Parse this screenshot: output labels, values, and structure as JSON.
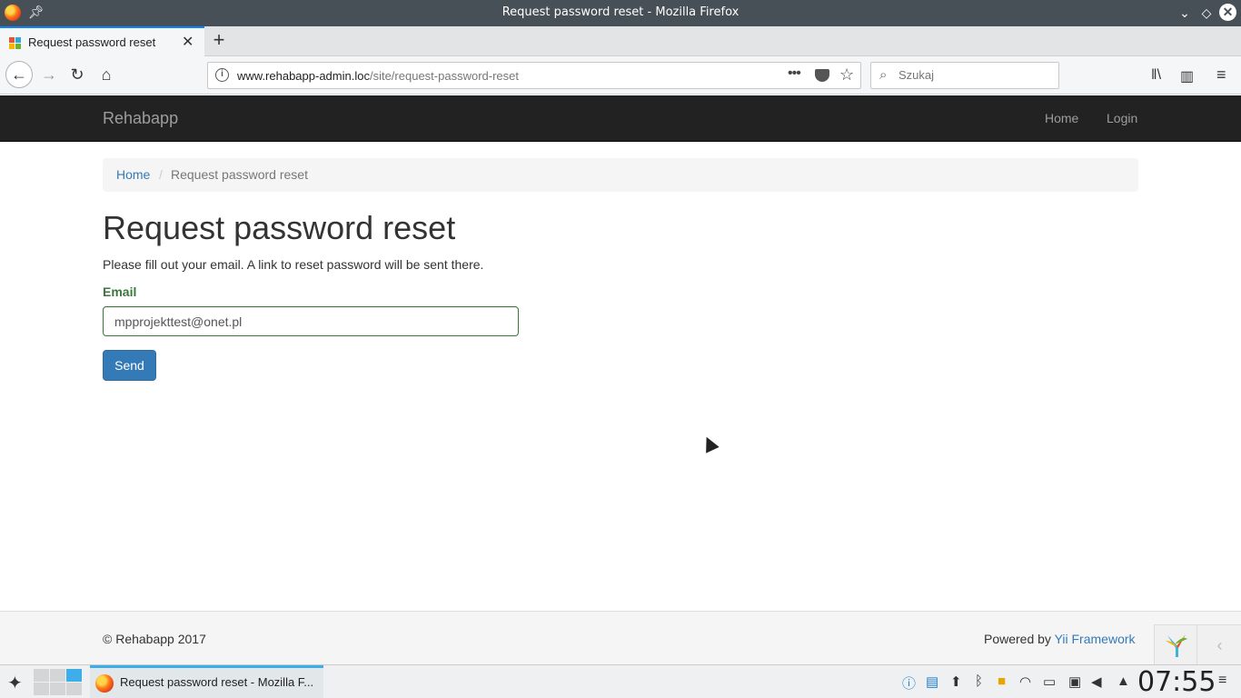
{
  "window": {
    "title": "Request password reset - Mozilla Firefox"
  },
  "browser": {
    "tab": {
      "label": "Request password reset"
    },
    "url": {
      "host": "www.rehabapp-admin.loc",
      "path": "/site/request-password-reset"
    },
    "search": {
      "placeholder": "Szukaj"
    }
  },
  "site": {
    "brand": "Rehabapp",
    "nav": {
      "home": "Home",
      "login": "Login"
    },
    "breadcrumb": {
      "home": "Home",
      "separator": "/",
      "active": "Request password reset"
    },
    "page": {
      "title": "Request password reset",
      "intro": "Please fill out your email. A link to reset password will be sent there.",
      "email_label": "Email",
      "email_value": "mpprojekttest@onet.pl",
      "send_label": "Send"
    },
    "footer": {
      "copyright": "© Rehabapp 2017",
      "powered_prefix": "Powered by ",
      "powered_link": "Yii Framework"
    }
  },
  "taskbar": {
    "task_label": "Request password reset - Mozilla F...",
    "clock": "07:55"
  },
  "colors": {
    "navbar_bg": "#222222",
    "link": "#337ab7",
    "success_green": "#3c763d",
    "button_primary": "#337ab7",
    "accent_blue": "#3daee9"
  }
}
